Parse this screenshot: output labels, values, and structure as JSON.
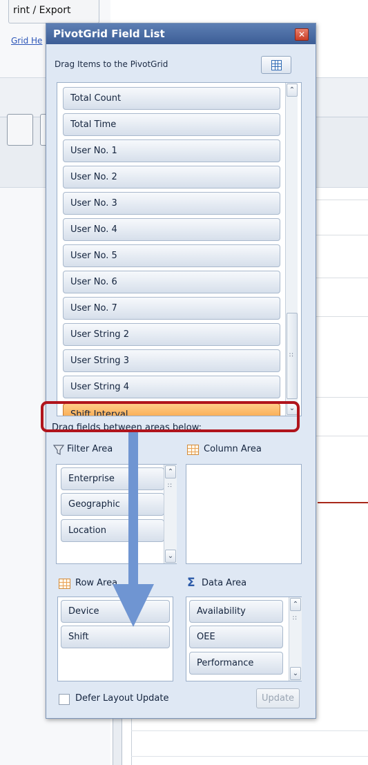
{
  "background": {
    "print_tab_label": "rint / Export",
    "link_text": "Grid He"
  },
  "dialog": {
    "title": "PivotGrid Field List",
    "close_glyph": "✕",
    "drag_items_label": "Drag Items to the PivotGrid",
    "fields": [
      "Total Count",
      "Total Time",
      "User No. 1",
      "User No. 2",
      "User No. 3",
      "User No. 4",
      "User No. 5",
      "User No. 6",
      "User No. 7",
      "User String 2",
      "User String 3",
      "User String 4",
      "Shift Interval"
    ],
    "selected_field": "Shift Interval",
    "areas_label": "Drag fields between areas below:",
    "filter_area": {
      "label": "Filter Area",
      "fields": [
        "Enterprise",
        "Geographic",
        "Location"
      ]
    },
    "column_area": {
      "label": "Column Area",
      "fields": []
    },
    "row_area": {
      "label": "Row Area",
      "fields": [
        "Device",
        "Shift"
      ]
    },
    "data_area": {
      "label": "Data Area",
      "fields": [
        "Availability",
        "OEE",
        "Performance"
      ]
    },
    "defer_label": "Defer Layout Update",
    "defer_checked": false,
    "update_label": "Update"
  },
  "colors": {
    "selected_field": "#f59a35",
    "highlight_border": "#b0141c",
    "arrow": "#6f95d2",
    "title_bar": "#3c5d96"
  },
  "icons": {
    "close": "close-icon",
    "layout": "layout-grid-icon",
    "filter": "funnel-icon",
    "column": "table-icon",
    "row": "table-icon",
    "data": "sigma-icon"
  }
}
